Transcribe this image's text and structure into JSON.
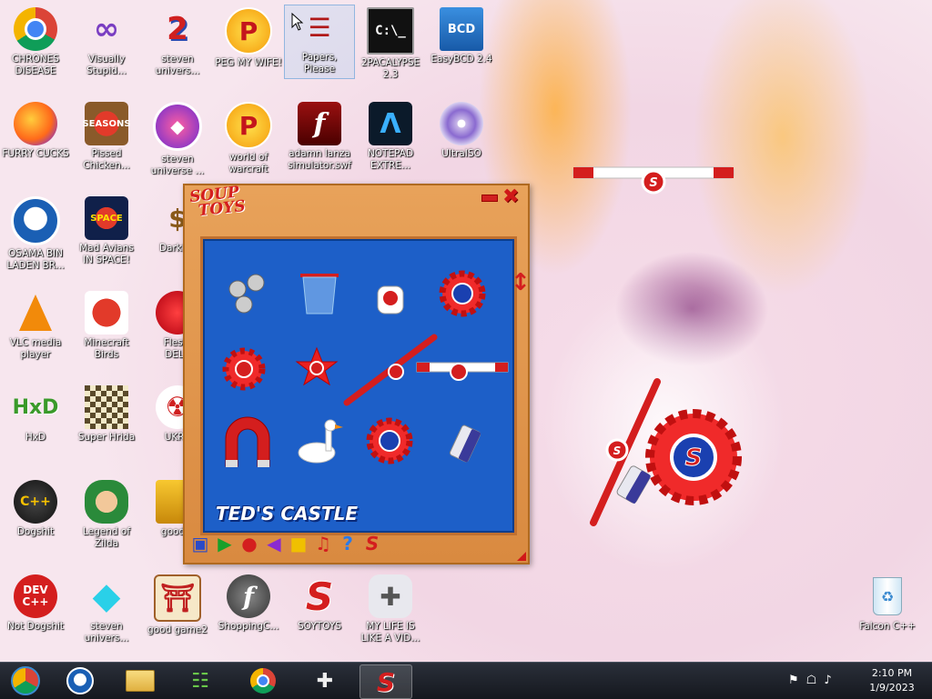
{
  "desktop": {
    "icons": [
      {
        "label": "CHRONES\nDISEASE",
        "icon": "chrome-icon"
      },
      {
        "label": "Visually\nStupid...",
        "icon": "visual-studio-icon"
      },
      {
        "label": "steven\nunivers...",
        "icon": "steven-universe-icon"
      },
      {
        "label": "PEG MY WIFE!",
        "icon": "peggle-icon"
      },
      {
        "label": "Papers,\nPlease",
        "icon": "papers-please-icon"
      },
      {
        "label": "2PACALYPSE\n2.3",
        "icon": "console-icon"
      },
      {
        "label": "EasyBCD 2.4",
        "icon": "easybcd-icon"
      },
      {
        "label": "FURRY CUCKS",
        "icon": "firefox-icon"
      },
      {
        "label": "Pissed\nChicken...",
        "icon": "angry-birds-seasons-icon"
      },
      {
        "label": "steven\nuniverse ...",
        "icon": "gem-icon"
      },
      {
        "label": "world of\nwarcraft",
        "icon": "peggle-icon"
      },
      {
        "label": "adamn lanza\nsimulator.swf",
        "icon": "flash-icon"
      },
      {
        "label": "NOTEPAD\nEXTRE...",
        "icon": "notepad-icon"
      },
      {
        "label": "UltraISO",
        "icon": "disc-icon"
      },
      {
        "label": "OSAMA BIN\nLADEN BR...",
        "icon": "obama-logo-icon"
      },
      {
        "label": "Mad Avians\nIN SPACE!",
        "icon": "angry-birds-space-icon"
      },
      {
        "label": "DarkOK",
        "icon": "moneybag-icon"
      },
      {
        "label": "VLC media\nplayer",
        "icon": "vlc-icon"
      },
      {
        "label": "Minecraft\nBirds",
        "icon": "angry-birds-icon"
      },
      {
        "label": "Fleshi\nDELU",
        "icon": "red-fuzzy-icon"
      },
      {
        "label": "HxD",
        "icon": "hxd-icon"
      },
      {
        "label": "Super Hrida",
        "icon": "pixel-icon"
      },
      {
        "label": "UKRA",
        "icon": "radiation-icon"
      },
      {
        "label": "Dogshit",
        "icon": "codeblocks-icon"
      },
      {
        "label": "Legend of\nZilda",
        "icon": "zelda-icon"
      },
      {
        "label": "good g",
        "icon": "gold-game-icon"
      },
      {
        "label": "Not Dogshit",
        "icon": "devcpp-icon"
      },
      {
        "label": "steven\nunivers...",
        "icon": "diamond-icon"
      },
      {
        "label": "good game2",
        "icon": "torii-icon"
      },
      {
        "label": "ShoppingC...",
        "icon": "flash-player-icon"
      },
      {
        "label": "SOYTOYS",
        "icon": "soup-toys-icon"
      },
      {
        "label": "MY LIFE IS\nLIKE A VID...",
        "icon": "gamepad-icon"
      },
      {
        "label": "Falcon C++",
        "icon": "recycle-bin-icon"
      }
    ]
  },
  "soup_toys": {
    "logo_line1": "SOUP",
    "logo_line2": "TOYS",
    "caption": "TED'S CASTLE",
    "toolbar": [
      "weight-tool",
      "play",
      "record",
      "rewind",
      "stop",
      "music",
      "help",
      "soup-s"
    ]
  },
  "taskbar": {
    "items": [
      "chrome-alt",
      "obama",
      "explorer",
      "network",
      "chrome",
      "gamepad",
      "soup-toys"
    ],
    "time": "2:10 PM",
    "date": "1/9/2023"
  },
  "colors": {
    "accent_red": "#d41e1e",
    "play_blue": "#1d5fc8",
    "wood": "#e09a50"
  }
}
